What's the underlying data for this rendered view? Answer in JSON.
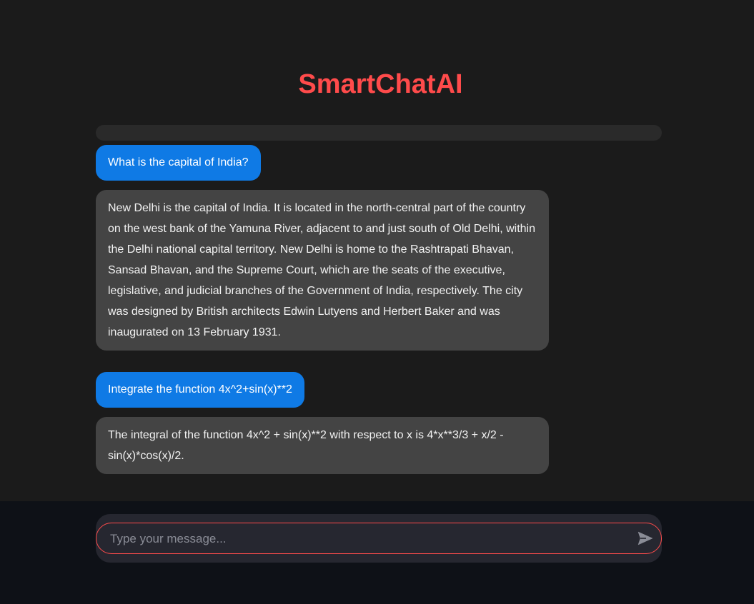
{
  "app": {
    "title": "SmartChatAI"
  },
  "colors": {
    "accent": "#ff4b4b",
    "user_bubble": "#0f7ae5",
    "bot_bubble": "#444444",
    "background": "#1b1b1b",
    "bottom_area": "#0e1117"
  },
  "messages": [
    {
      "role": "user",
      "text": "What is the capital of India?"
    },
    {
      "role": "assistant",
      "text": "New Delhi is the capital of India. It is located in the north-central part of the country on the west bank of the Yamuna River, adjacent to and just south of Old Delhi, within the Delhi national capital territory. New Delhi is home to the Rashtrapati Bhavan, Sansad Bhavan, and the Supreme Court, which are the seats of the executive, legislative, and judicial branches of the Government of India, respectively. The city was designed by British architects Edwin Lutyens and Herbert Baker and was inaugurated on 13 February 1931."
    },
    {
      "role": "user",
      "text": "Integrate the function 4x^2+sin(x)**2"
    },
    {
      "role": "assistant",
      "text": "The integral of the function 4x^2 + sin(x)**2 with respect to x is 4*x**3/3 + x/2 - sin(x)*cos(x)/2."
    }
  ],
  "input": {
    "placeholder": "Type your message...",
    "value": "",
    "send_icon": "send-icon"
  }
}
